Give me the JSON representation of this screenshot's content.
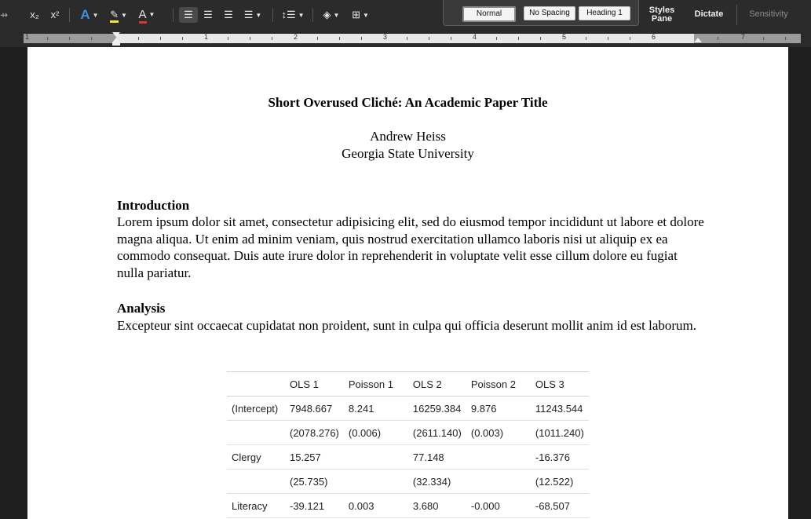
{
  "toolbar": {
    "subscript_icon": "x₂",
    "superscript_icon": "x²",
    "text_effects_icon": "A",
    "highlight_icon": "✎",
    "font_color_icon": "A",
    "styles": [
      "Normal",
      "No Spacing",
      "Heading 1"
    ],
    "styles_pane_label": "Styles Pane",
    "dictate_label": "Dictate",
    "sensitivity_label": "Sensitivity",
    "colors": {
      "highlight": "#f5e23a",
      "font_color": "#e0352b",
      "text_effects": "#3f8fe0"
    }
  },
  "ruler": {
    "numbers": [
      "1",
      "1",
      "2",
      "3",
      "4",
      "5",
      "6",
      "7"
    ]
  },
  "document": {
    "title": "Short Overused Cliché: An Academic Paper Title",
    "author": "Andrew Heiss",
    "affiliation": "Georgia State University",
    "sections": [
      {
        "heading": "Introduction",
        "text": "Lorem ipsum dolor sit amet, consectetur adipisicing elit, sed do eiusmod tempor incididunt ut labore et dolore magna aliqua. Ut enim ad minim veniam, quis nostrud exercitation ullamco laboris nisi ut aliquip ex ea commodo consequat. Duis aute irure dolor in reprehenderit in voluptate velit esse cillum dolore eu fugiat nulla pariatur."
      },
      {
        "heading": "Analysis",
        "text": "Excepteur sint occaecat cupidatat non proident, sunt in culpa qui officia deserunt mollit anim id est laborum."
      }
    ],
    "table": {
      "headers": [
        "",
        "OLS 1",
        "Poisson 1",
        "OLS 2",
        "Poisson 2",
        "OLS 3"
      ],
      "rows": [
        [
          "(Intercept)",
          "7948.667",
          "8.241",
          "16259.384",
          "9.876",
          "11243.544"
        ],
        [
          "",
          "(2078.276)",
          "(0.006)",
          "(2611.140)",
          "(0.003)",
          "(1011.240)"
        ],
        [
          "Clergy",
          "15.257",
          "",
          "77.148",
          "",
          "-16.376"
        ],
        [
          "",
          "(25.735)",
          "",
          "(32.334)",
          "",
          "(12.522)"
        ],
        [
          "Literacy",
          "-39.121",
          "0.003",
          "3.680",
          "-0.000",
          "-68.507"
        ]
      ]
    }
  }
}
